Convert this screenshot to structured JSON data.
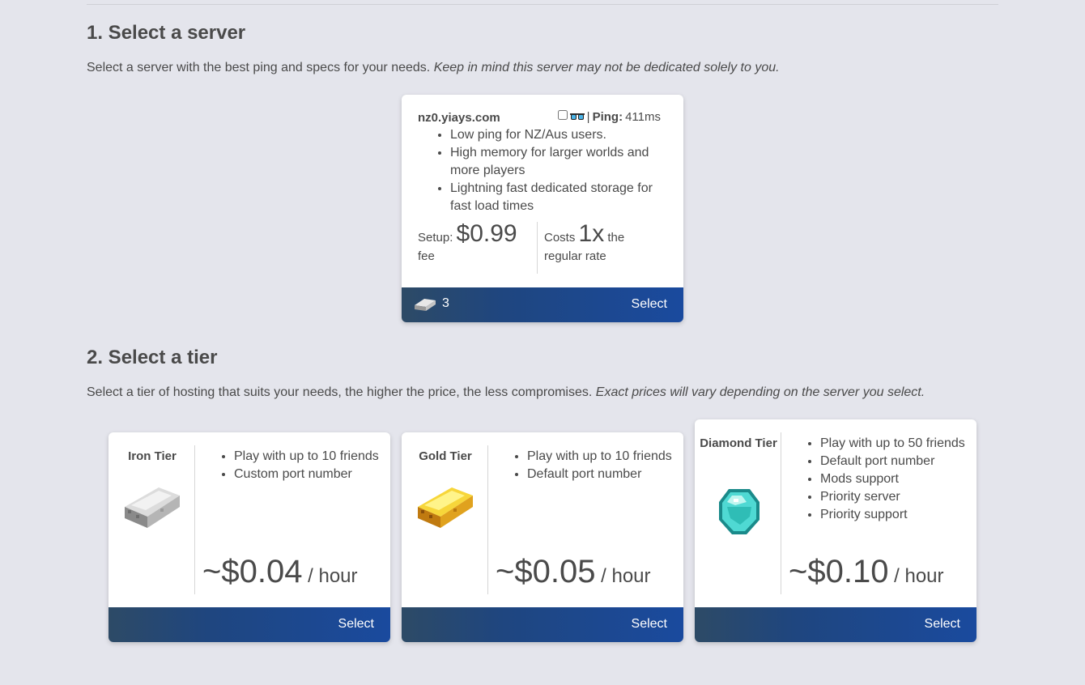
{
  "section1": {
    "title": "1. Select a server",
    "desc": "Select a server with the best ping and specs for your needs. ",
    "desc_em": "Keep in mind this server may not be dedicated solely to you."
  },
  "server": {
    "host": "nz0.yiays.com",
    "ping_sep": "| ",
    "ping_label": "Ping:",
    "ping_value": " 411ms",
    "features": [
      "Low ping for NZ/Aus users.",
      "High memory for larger worlds and more players",
      "Lightning fast dedicated storage for fast load times"
    ],
    "setup_label": "Setup:",
    "setup_price": "$0.99",
    "setup_suffix": "fee",
    "costs_label": "Costs",
    "costs_mult": "1x",
    "costs_suffix": "the regular rate",
    "ingot_count": "3",
    "select_label": "Select"
  },
  "section2": {
    "title": "2. Select a tier",
    "desc": "Select a tier of hosting that suits your needs, the higher the price, the less compromises. ",
    "desc_em": "Exact prices will vary depending on the server you select."
  },
  "tiers": [
    {
      "name": "Iron Tier",
      "icon": "iron-ingot-icon",
      "features": [
        "Play with up to 10 friends",
        "Custom port number"
      ],
      "price": "~$0.04",
      "unit": " / hour",
      "select_label": "Select"
    },
    {
      "name": "Gold Tier",
      "icon": "gold-ingot-icon",
      "features": [
        "Play with up to 10 friends",
        "Default port number"
      ],
      "price": "~$0.05",
      "unit": " / hour",
      "select_label": "Select"
    },
    {
      "name": "Diamond Tier",
      "icon": "diamond-icon",
      "features": [
        "Play with up to 50 friends",
        "Default port number",
        "Mods support",
        "Priority server",
        "Priority support"
      ],
      "price": "~$0.10",
      "unit": " / hour",
      "select_label": "Select"
    }
  ],
  "colors": {
    "background": "#e4e5ec",
    "footer_start": "#2d4a66",
    "footer_end": "#1a4a9e",
    "text": "#4a4a4a"
  }
}
